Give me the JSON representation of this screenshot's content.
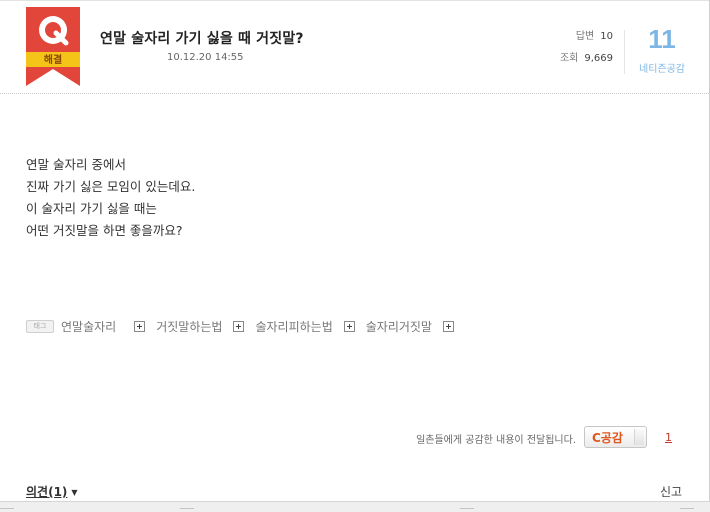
{
  "question": {
    "badge_letter": "Q",
    "badge_label": "해결",
    "title": "연말 술자리 가기 싫을 때 거짓말?",
    "date": "10.12.20 14:55"
  },
  "stats": {
    "answers_label": "답변",
    "answers_value": "10",
    "views_label": "조회",
    "views_value": "9,669"
  },
  "empathy": {
    "count": "11",
    "label": "네티즌공감",
    "notice": "일촌들에게 공감한 내용이 전달됩니다.",
    "button_label": "C공감",
    "button_count": "1"
  },
  "body": {
    "lines": [
      "연말 술자리 중에서",
      "진짜 가기 싫은 모임이 있는데요.",
      "이 술자리 가기 싫을 때는",
      "어떤 거짓말을 하면 좋을까요?"
    ]
  },
  "tags": {
    "icon_text": "태그",
    "items": [
      "연말술자리",
      "거짓말하는법",
      "술자리피하는법",
      "술자리거짓말"
    ]
  },
  "footer": {
    "comments_label": "의견(1)",
    "report_label": "신고"
  },
  "colors": {
    "badge_red": "#e2463a",
    "badge_yellow": "#f5c419",
    "empathy_blue": "#7db6e4",
    "empathy_button_orange": "#e0561e"
  }
}
